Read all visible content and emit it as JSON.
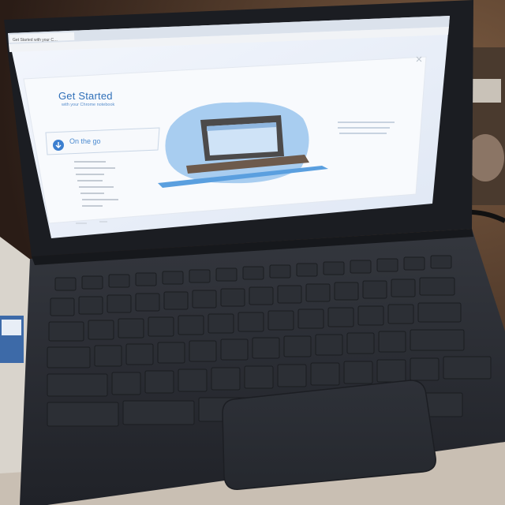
{
  "photo": {
    "subject": "laptop-with-chrome-os-get-started-screen"
  },
  "browser": {
    "tab_title": "Get Started with your C…",
    "page_title": "Get Started",
    "page_subtitle": "with your Chrome notebook",
    "active_section": "On the go"
  },
  "colors": {
    "accent": "#3c7fd0",
    "screen_bg": "#eef2f9",
    "laptop_body": "#2a2d33"
  }
}
